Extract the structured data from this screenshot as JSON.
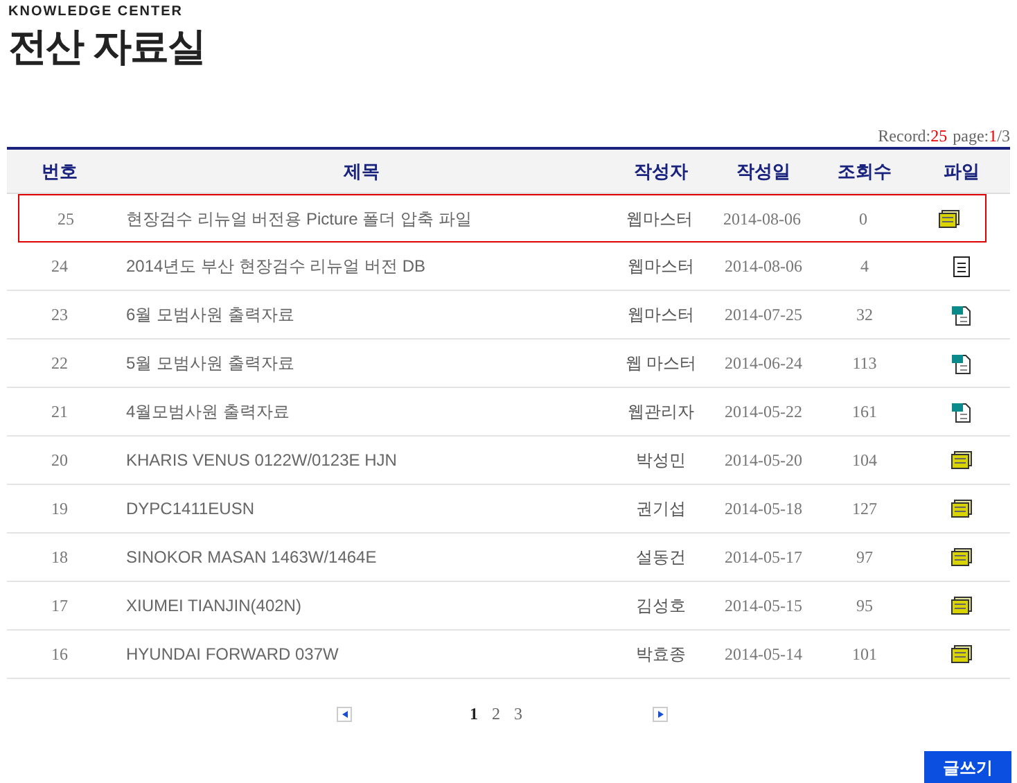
{
  "header": {
    "eyebrow": "KNOWLEDGE CENTER",
    "title": "전산 자료실"
  },
  "summary": {
    "record_label": "Record:",
    "record_count": "25",
    "page_label": "page:",
    "page_current": "1",
    "page_total": "/3"
  },
  "table": {
    "columns": [
      "번호",
      "제목",
      "작성자",
      "작성일",
      "조회수",
      "파일"
    ],
    "rows": [
      {
        "number": "25",
        "title": "현장검수 리뉴얼 버전용 Picture 폴더 압축 파일",
        "author": "웹마스터",
        "date": "2014-08-06",
        "views": "0",
        "file": {
          "kind": "archive"
        },
        "selected": true
      },
      {
        "number": "24",
        "title": "2014년도 부산 현장검수 리뉴얼 버전 DB",
        "author": "웹마스터",
        "date": "2014-08-06",
        "views": "4",
        "file": {
          "kind": "text"
        },
        "selected": false
      },
      {
        "number": "23",
        "title": "6월 모범사원 출력자료",
        "author": "웹마스터",
        "date": "2014-07-25",
        "views": "32",
        "file": {
          "kind": "word"
        },
        "selected": false
      },
      {
        "number": "22",
        "title": "5월 모범사원 출력자료",
        "author": "웹 마스터",
        "date": "2014-06-24",
        "views": "113",
        "file": {
          "kind": "word"
        },
        "selected": false
      },
      {
        "number": "21",
        "title": "4월모범사원 출력자료",
        "author": "웹관리자",
        "date": "2014-05-22",
        "views": "161",
        "file": {
          "kind": "word"
        },
        "selected": false
      },
      {
        "number": "20",
        "title": "KHARIS VENUS 0122W/0123E HJN",
        "author": "박성민",
        "date": "2014-05-20",
        "views": "104",
        "file": {
          "kind": "archive"
        },
        "selected": false
      },
      {
        "number": "19",
        "title": "DYPC1411EUSN",
        "author": "권기섭",
        "date": "2014-05-18",
        "views": "127",
        "file": {
          "kind": "archive"
        },
        "selected": false
      },
      {
        "number": "18",
        "title": "SINOKOR MASAN 1463W/1464E",
        "author": "설동건",
        "date": "2014-05-17",
        "views": "97",
        "file": {
          "kind": "archive"
        },
        "selected": false
      },
      {
        "number": "17",
        "title": "XIUMEI TIANJIN(402N)",
        "author": "김성호",
        "date": "2014-05-15",
        "views": "95",
        "file": {
          "kind": "archive"
        },
        "selected": false
      },
      {
        "number": "16",
        "title": "HYUNDAI FORWARD 037W",
        "author": "박효종",
        "date": "2014-05-14",
        "views": "101",
        "file": {
          "kind": "archive"
        },
        "selected": false
      }
    ]
  },
  "pagination": {
    "pages": [
      {
        "label": "1",
        "selected": true
      },
      {
        "label": "2",
        "selected": false
      },
      {
        "label": "3",
        "selected": false
      }
    ]
  },
  "write_button": "글쓰기"
}
